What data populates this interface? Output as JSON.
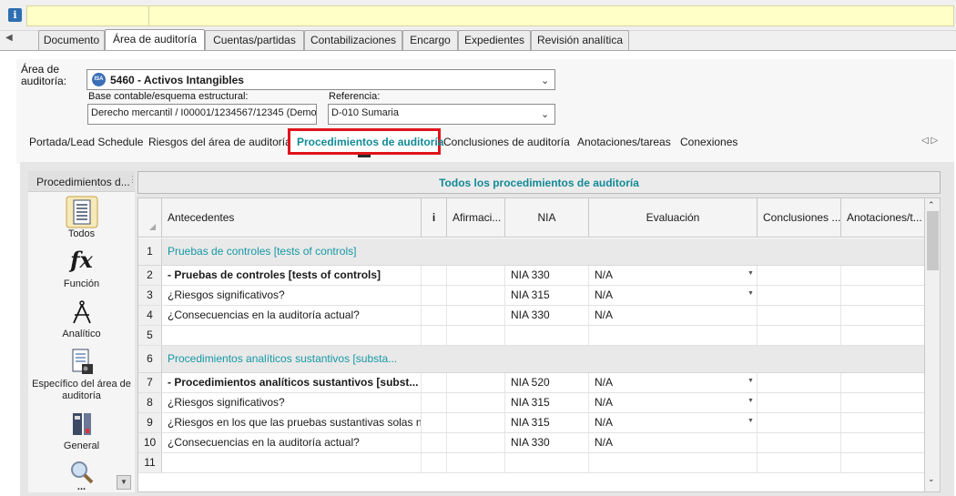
{
  "info_icon": "i",
  "top_tabs": [
    {
      "label": "Documento"
    },
    {
      "label": "Área de auditoría"
    },
    {
      "label": "Cuentas/partidas"
    },
    {
      "label": "Contabilizaciones"
    },
    {
      "label": "Encargo"
    },
    {
      "label": "Expedientes"
    },
    {
      "label": "Revisión analítica"
    }
  ],
  "top_tabs_scroll_glyph": "◀",
  "area": {
    "label": "Área de auditoría:",
    "badge": "ISA",
    "value": "5460 - Activos Intangibles",
    "base_label": "Base contable/esquema estructural:",
    "base_value": "Derecho mercantil / I00001/1234567/12345 (Demo",
    "ref_label": "Referencia:",
    "ref_value": "D-010  Sumaria"
  },
  "sub_tabs": [
    {
      "label": "Portada/Lead Schedule"
    },
    {
      "label": "Riesgos del área de auditoría"
    },
    {
      "label": "Procedimientos de auditoría"
    },
    {
      "label": "Conclusiones de auditoría"
    },
    {
      "label": "Anotaciones/tareas"
    },
    {
      "label": "Conexiones"
    }
  ],
  "sub_tabs_nav": "◁ ▷",
  "sidebar": {
    "header": "Procedimientos d...",
    "items": [
      {
        "label": "Todos",
        "icon": "list-icon"
      },
      {
        "label": "Función",
        "icon": "function-icon"
      },
      {
        "label": "Analítico",
        "icon": "compass-icon"
      },
      {
        "label": "Específico del área de auditoría",
        "icon": "specific-icon"
      },
      {
        "label": "General",
        "icon": "general-icon"
      },
      {
        "label": "...",
        "icon": "magnifier-icon"
      }
    ]
  },
  "grid": {
    "title": "Todos los procedimientos de auditoría",
    "columns": [
      "",
      "Antecedentes",
      "i",
      "Afirmaci...",
      "NIA",
      "Evaluación",
      "Conclusiones ...",
      "Anotaciones/t..."
    ],
    "rows": [
      {
        "n": "1",
        "text": "Pruebas de controles [tests of controls]",
        "section": true,
        "nia": "",
        "eval": ""
      },
      {
        "n": "2",
        "text": "- Pruebas de controles [tests of controls]",
        "bold": true,
        "nia": "NIA 330",
        "eval": "N/A",
        "dd": true
      },
      {
        "n": "3",
        "text": "¿Riesgos significativos?",
        "nia": "NIA 315",
        "eval": "N/A",
        "dd": true
      },
      {
        "n": "4",
        "text": "¿Consecuencias en la auditoría actual?",
        "nia": "NIA 330",
        "eval": "N/A"
      },
      {
        "n": "5",
        "text": "",
        "nia": "",
        "eval": ""
      },
      {
        "n": "6",
        "text": "Procedimientos analíticos sustantivos [substa...",
        "section": true,
        "nia": "",
        "eval": ""
      },
      {
        "n": "7",
        "text": "- Procedimientos analíticos sustantivos [subst...",
        "bold": true,
        "nia": "NIA 520",
        "eval": "N/A",
        "dd": true
      },
      {
        "n": "8",
        "text": "¿Riesgos significativos?",
        "nia": "NIA 315",
        "eval": "N/A",
        "dd": true
      },
      {
        "n": "9",
        "text": "¿Riesgos en los que las pruebas sustantivas solas n...",
        "nia": "NIA 315",
        "eval": "N/A",
        "dd": true
      },
      {
        "n": "10",
        "text": "¿Consecuencias en la auditoría actual?",
        "nia": "NIA 330",
        "eval": "N/A"
      },
      {
        "n": "11",
        "text": "",
        "nia": "",
        "eval": ""
      }
    ]
  },
  "colors": {
    "accent": "#138a96",
    "highlight": "#e1141b",
    "info_bg": "#ffffc8"
  }
}
